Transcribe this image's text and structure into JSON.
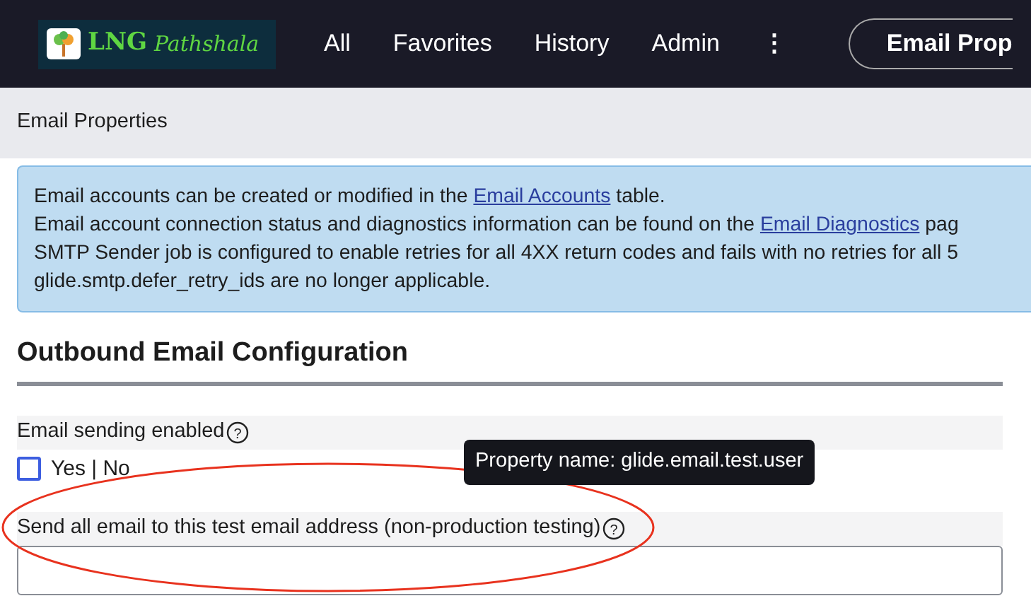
{
  "navbar": {
    "logo": {
      "text_1": "LNG",
      "text_2": "Pathshala"
    },
    "menu": [
      "All",
      "Favorites",
      "History",
      "Admin"
    ],
    "more": "⋮",
    "context_button": "Email Prop"
  },
  "header": {
    "title": "Email Properties"
  },
  "info": {
    "lines": [
      {
        "before": "Email accounts can be created or modified in the ",
        "link": "Email Accounts",
        "after": " table."
      },
      {
        "before": "Email account connection status and diagnostics information can be found on the ",
        "link": "Email Diagnostics",
        "after": " pag"
      },
      {
        "before": "SMTP Sender job is configured to enable retries for all 4XX return codes and fails with no retries for all 5"
      },
      {
        "before": "glide.smtp.defer_retry_ids are no longer applicable."
      }
    ]
  },
  "section": {
    "title": "Outbound Email Configuration",
    "properties": [
      {
        "kind": "checkbox",
        "label": "Email sending enabled",
        "help": "?",
        "checked": false,
        "option": "Yes | No"
      },
      {
        "kind": "text",
        "label": "Send all email to this test email address (non-production testing)",
        "help": "?"
      }
    ]
  },
  "tooltip": "Property name: glide.email.test.user"
}
